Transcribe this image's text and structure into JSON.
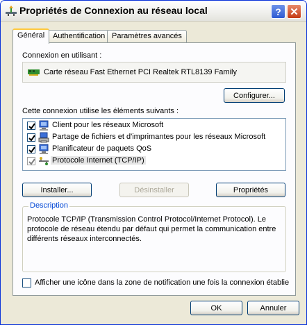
{
  "window": {
    "title": "Propriétés de Connexion au réseau local",
    "help_glyph": "?",
    "close_glyph": "✕"
  },
  "tabs": [
    {
      "label": "Général",
      "active": true
    },
    {
      "label": "Authentification",
      "active": false
    },
    {
      "label": "Paramètres avancés",
      "active": false
    }
  ],
  "general": {
    "connect_using_label": "Connexion en utilisant :",
    "adapter_name": "Carte réseau Fast Ethernet PCI Realtek RTL8139 Family",
    "configure_button": "Configurer...",
    "items_label": "Cette connexion utilise les éléments suivants :",
    "items": [
      {
        "label": "Client pour les réseaux Microsoft",
        "checked": true,
        "icon": "network-client-icon",
        "selected": false
      },
      {
        "label": "Partage de fichiers et d'imprimantes pour les réseaux Microsoft",
        "checked": true,
        "icon": "file-printer-sharing-icon",
        "selected": false
      },
      {
        "label": "Planificateur de paquets QoS",
        "checked": true,
        "icon": "qos-scheduler-icon",
        "selected": false
      },
      {
        "label": "Protocole Internet (TCP/IP)",
        "checked": true,
        "icon": "protocol-icon",
        "selected": true
      }
    ],
    "install_button": "Installer...",
    "uninstall_button": "Désinstaller",
    "properties_button": "Propriétés",
    "description_title": "Description",
    "description_text": "Protocole TCP/IP (Transmission Control Protocol/Internet Protocol). Le protocole de réseau étendu par défaut qui permet la communication entre différents réseaux interconnectés.",
    "show_icon_label": "Afficher une icône dans la zone de notification une fois la connexion établie",
    "show_icon_checked": false
  },
  "footer": {
    "ok_button": "OK",
    "cancel_button": "Annuler"
  },
  "colors": {
    "window_frame": "#0831d9",
    "dialog_background": "#ece9d8",
    "panel_background": "#fcfcfe",
    "group_title_blue": "#0046d5",
    "active_tab_accent": "#ffc83c"
  }
}
